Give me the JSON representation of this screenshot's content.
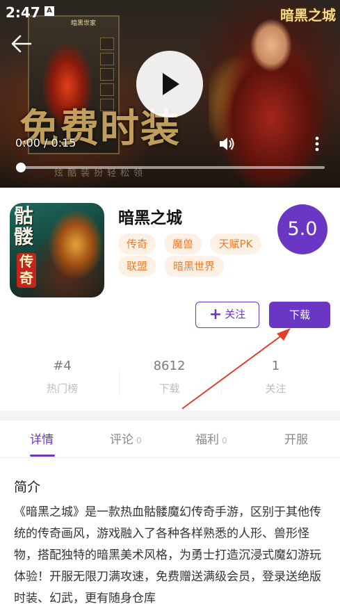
{
  "status_bar": {
    "time": "2:47",
    "notification_icon": "A"
  },
  "video": {
    "frame_title": "暗黑世家",
    "slogan": "免费时装",
    "slogan_sub": "炫酷装扮轻松领",
    "brand_logo": "暗黑之城",
    "time_label": "0:00 / 0:15",
    "progress": 0.0,
    "icons": {
      "back": "arrow-left-icon",
      "play": "play-icon",
      "volume": "volume-icon",
      "more": "more-vertical-icon"
    }
  },
  "app": {
    "name": "暗黑之城",
    "icon_text": "骷髅",
    "icon_badge": "传奇",
    "score": "5.0",
    "tags": [
      "传奇",
      "魔兽",
      "天赋PK",
      "联盟",
      "暗黑世界"
    ],
    "follow_label": "关注",
    "download_label": "下载",
    "colors": {
      "accent": "#6a37c4",
      "tag_text": "#f07a28",
      "tag_bg": "#fdf1e6"
    }
  },
  "stats": [
    {
      "value": "#4",
      "label": "热门榜"
    },
    {
      "value": "8612",
      "label": "下载"
    },
    {
      "value": "1",
      "label": "关注"
    }
  ],
  "tabs": [
    {
      "label": "详情",
      "count": ""
    },
    {
      "label": "评论",
      "count": "0"
    },
    {
      "label": "福利",
      "count": "0"
    },
    {
      "label": "开服",
      "count": ""
    }
  ],
  "intro": {
    "title": "简介",
    "body": "《暗黑之城》是一款热血骷髅魔幻传奇手游，区别于其他传统的传奇画风，游戏融入了各种各样熟悉的人形、兽形怪物，搭配独特的暗黑美术风格，为勇士打造沉浸式魔幻游玩体验！开服无限刀满攻速，免费赠送满级会员，登录送绝版时装、幻武，更有随身仓库"
  }
}
